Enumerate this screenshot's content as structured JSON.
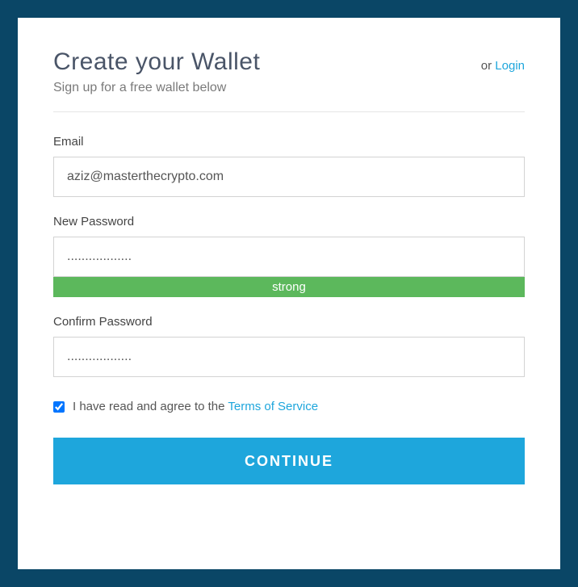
{
  "header": {
    "title": "Create your Wallet",
    "orText": "or ",
    "loginLink": "Login"
  },
  "subtitle": "Sign up for a free wallet below",
  "fields": {
    "email": {
      "label": "Email",
      "value": "aziz@masterthecrypto.com"
    },
    "newPassword": {
      "label": "New Password",
      "value": "..................",
      "strength": "strong"
    },
    "confirmPassword": {
      "label": "Confirm Password",
      "value": ".................."
    }
  },
  "terms": {
    "checked": true,
    "textPrefix": "I have read and agree to the ",
    "linkText": "Terms of Service"
  },
  "continueButton": "CONTINUE"
}
